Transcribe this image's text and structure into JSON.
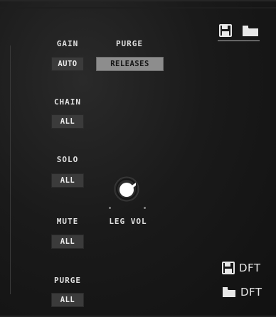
{
  "left_column": {
    "gain": {
      "label": "GAIN",
      "value": "AUTO"
    },
    "chain": {
      "label": "CHAIN",
      "value": "ALL"
    },
    "solo": {
      "label": "SOLO",
      "value": "ALL"
    },
    "mute": {
      "label": "MUTE",
      "value": "ALL"
    },
    "purge": {
      "label": "PURGE",
      "value": "ALL"
    }
  },
  "purge_top": {
    "label": "PURGE",
    "value": "RELEASES"
  },
  "leg_vol": {
    "label": "LEG VOL"
  },
  "defaults": {
    "save_label": "DFT",
    "load_label": "DFT"
  },
  "icons": {
    "top_save": "floppy-disk-icon",
    "top_load": "folder-icon",
    "dft_save": "floppy-disk-icon",
    "dft_load": "folder-icon"
  },
  "colors": {
    "background": "#1a1a1a",
    "button": "#3b3b3b",
    "button_active": "#8d8d8d",
    "text": "#e0e0e0"
  }
}
